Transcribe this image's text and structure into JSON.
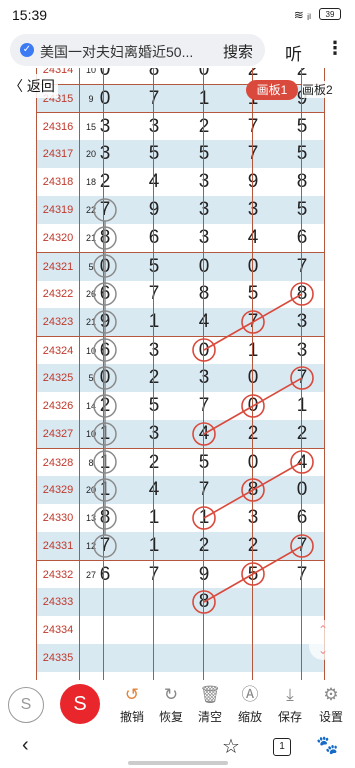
{
  "status": {
    "time": "15:39",
    "battery": "39"
  },
  "address": {
    "title": "美国一对夫妇离婚近50...",
    "search_label": "搜索"
  },
  "listen_label": "听",
  "more_label": "⋮",
  "board": {
    "back_label": "〈 返回",
    "pad1_label": "画板1",
    "pad2_label": "画板2",
    "rows": [
      {
        "id": "24314",
        "count": "10",
        "digits": [
          "0",
          "8",
          "0",
          "2",
          "2"
        ]
      },
      {
        "id": "24315",
        "count": "9",
        "digits": [
          "0",
          "7",
          "1",
          "1",
          "9"
        ]
      },
      {
        "id": "24316",
        "count": "15",
        "digits": [
          "3",
          "3",
          "2",
          "7",
          "5"
        ]
      },
      {
        "id": "24317",
        "count": "20",
        "digits": [
          "3",
          "5",
          "5",
          "7",
          "5"
        ]
      },
      {
        "id": "24318",
        "count": "18",
        "digits": [
          "2",
          "4",
          "3",
          "9",
          "8"
        ]
      },
      {
        "id": "24319",
        "count": "22",
        "digits": [
          "7",
          "9",
          "3",
          "3",
          "5"
        ]
      },
      {
        "id": "24320",
        "count": "21",
        "digits": [
          "8",
          "6",
          "3",
          "4",
          "6"
        ]
      },
      {
        "id": "24321",
        "count": "5",
        "digits": [
          "0",
          "5",
          "0",
          "0",
          "7"
        ]
      },
      {
        "id": "24322",
        "count": "26",
        "digits": [
          "6",
          "7",
          "8",
          "5",
          "8"
        ]
      },
      {
        "id": "24323",
        "count": "21",
        "digits": [
          "9",
          "1",
          "4",
          "7",
          "3"
        ]
      },
      {
        "id": "24324",
        "count": "10",
        "digits": [
          "6",
          "3",
          "0",
          "1",
          "3"
        ]
      },
      {
        "id": "24325",
        "count": "5",
        "digits": [
          "0",
          "2",
          "3",
          "0",
          "7"
        ]
      },
      {
        "id": "24326",
        "count": "14",
        "digits": [
          "2",
          "5",
          "7",
          "0",
          "1"
        ]
      },
      {
        "id": "24327",
        "count": "10",
        "digits": [
          "1",
          "3",
          "4",
          "2",
          "2"
        ]
      },
      {
        "id": "24328",
        "count": "8",
        "digits": [
          "1",
          "2",
          "5",
          "0",
          "4"
        ]
      },
      {
        "id": "24329",
        "count": "20",
        "digits": [
          "1",
          "4",
          "7",
          "8",
          "0"
        ]
      },
      {
        "id": "24330",
        "count": "13",
        "digits": [
          "8",
          "1",
          "1",
          "3",
          "6"
        ]
      },
      {
        "id": "24331",
        "count": "12",
        "digits": [
          "7",
          "1",
          "2",
          "2",
          "7"
        ]
      },
      {
        "id": "24332",
        "count": "27",
        "digits": [
          "6",
          "7",
          "9",
          "5",
          "7"
        ]
      },
      {
        "id": "24333",
        "count": "",
        "digits": [
          "",
          "",
          "8",
          "",
          ""
        ]
      },
      {
        "id": "24334",
        "count": "",
        "digits": [
          "",
          "",
          "",
          "",
          ""
        ]
      },
      {
        "id": "24335",
        "count": "",
        "digits": [
          "",
          "",
          "",
          "",
          ""
        ]
      }
    ]
  },
  "toolbar": {
    "undo": "撤销",
    "redo": "恢复",
    "clear": "清空",
    "zoom": "缩放",
    "save": "保存",
    "settings": "设置"
  },
  "nav": {
    "tabs_count": "1"
  },
  "colors": {
    "accent": "#d94a3c",
    "grid": "#b5573c",
    "shade": "#d9e9f2",
    "gray_marks": "#8a8a8a"
  }
}
